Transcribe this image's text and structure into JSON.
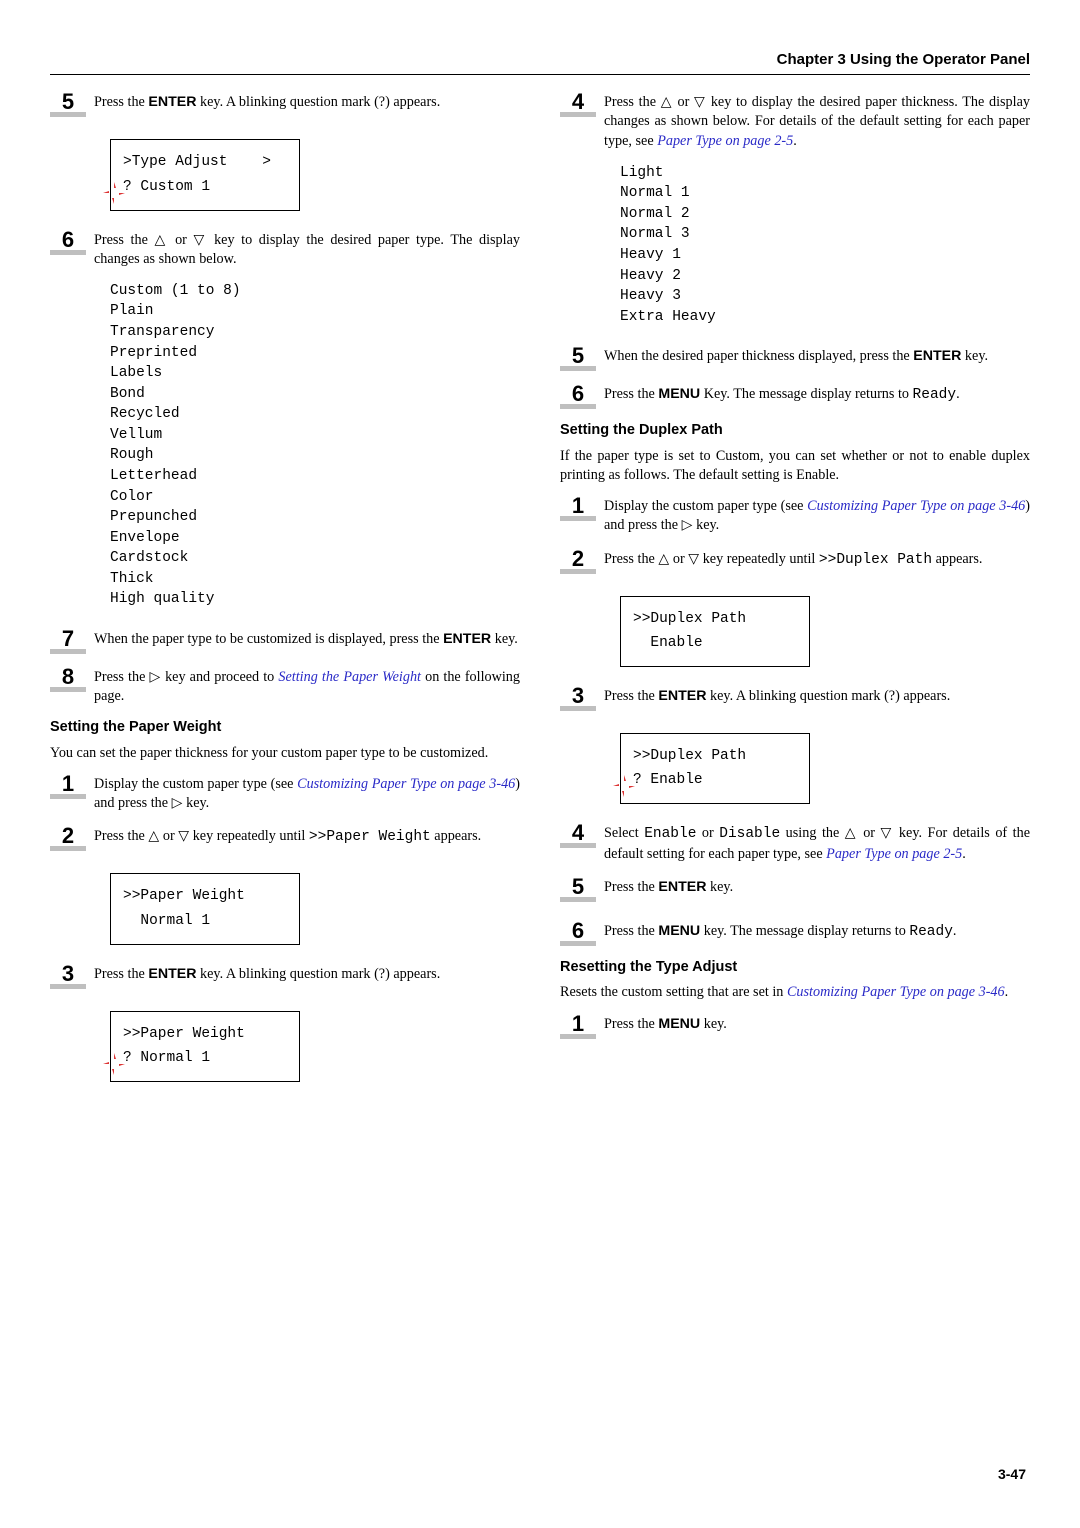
{
  "chapter_title": "Chapter 3  Using the Operator Panel",
  "page_number": "3-47",
  "glyph": {
    "up": "△",
    "down": "▽",
    "right": "▷"
  },
  "left": {
    "s5": {
      "num": "5",
      "text_a": "Press the ",
      "enter": "ENTER",
      "text_b": " key. A blinking question mark (?) appears."
    },
    "lcd1": {
      "l1": ">Type Adjust    >",
      "l2": "? Custom 1"
    },
    "s6": {
      "num": "6",
      "text_a": "Press the ",
      "or": " or ",
      "text_b": " key to display the desired paper type. The display changes as shown below."
    },
    "type_list": "Custom (1 to 8)\nPlain\nTransparency\nPreprinted\nLabels\nBond\nRecycled\nVellum\nRough\nLetterhead\nColor\nPrepunched\nEnvelope\nCardstock\nThick\nHigh quality",
    "s7": {
      "num": "7",
      "text": "When the paper type to be customized is displayed, press the ",
      "enter": "ENTER",
      "tail": " key."
    },
    "s8": {
      "num": "8",
      "text_a": "Press the ",
      "text_b": " key and proceed to ",
      "xref": "Setting the Paper Weight",
      "tail": " on the following page."
    },
    "h_weight": "Setting the Paper Weight",
    "p_weight": "You can set the paper thickness for your custom paper type to be customized.",
    "w1": {
      "num": "1",
      "text_a": "Display the custom paper type (see ",
      "xref": "Customizing Paper Type on page 3-46",
      "text_b": ") and press the ",
      "tail": " key."
    },
    "w2": {
      "num": "2",
      "text_a": "Press the ",
      "or": " or ",
      "text_b": " key repeatedly until ",
      "code": ">>Paper Weight",
      "tail": " appears."
    },
    "lcd2": {
      "l1": ">>Paper Weight",
      "l2": "  Normal 1"
    },
    "w3": {
      "num": "3",
      "text_a": "Press the ",
      "enter": "ENTER",
      "text_b": " key. A blinking question mark (?) appears."
    },
    "lcd3": {
      "l1": ">>Paper Weight",
      "l2": "? Normal 1"
    }
  },
  "right": {
    "r4": {
      "num": "4",
      "text_a": "Press the ",
      "or": " or ",
      "text_b": " key to display the desired paper thickness. The display changes as shown below. For details of the default setting for each paper type, see ",
      "xref": "Paper Type on page 2-5",
      "tail": "."
    },
    "thick_list": "Light\nNormal 1\nNormal 2\nNormal 3\nHeavy 1\nHeavy 2\nHeavy 3\nExtra Heavy",
    "r5": {
      "num": "5",
      "text_a": "When the desired paper thickness displayed, press the ",
      "enter": "ENTER",
      "tail": " key."
    },
    "r6": {
      "num": "6",
      "text_a": "Press the ",
      "menu": "MENU",
      "text_b": " Key. The message display returns to ",
      "code": "Ready",
      "tail": "."
    },
    "h_duplex": "Setting the Duplex Path",
    "p_duplex": "If the paper type is set to Custom, you can set whether or not to enable duplex printing as follows. The default setting is Enable.",
    "d1": {
      "num": "1",
      "text_a": "Display the custom paper type (see ",
      "xref": "Customizing Paper Type on page 3-46",
      "text_b": ") and press the ",
      "tail": " key."
    },
    "d2": {
      "num": "2",
      "text_a": "Press the ",
      "or": " or ",
      "text_b": " key repeatedly until ",
      "code": ">>Duplex Path",
      "tail": " appears."
    },
    "lcd_d1": {
      "l1": ">>Duplex Path",
      "l2": "  Enable"
    },
    "d3": {
      "num": "3",
      "text_a": "Press the ",
      "enter": "ENTER",
      "text_b": " key. A blinking question mark (?) appears."
    },
    "lcd_d2": {
      "l1": ">>Duplex Path",
      "l2": "? Enable"
    },
    "d4": {
      "num": "4",
      "text_a": "Select ",
      "code1": "Enable",
      "or_txt": " or ",
      "code2": "Disable",
      "text_b": " using the ",
      "or": " or ",
      "text_c": " key. For details of the default setting for each paper type, see ",
      "xref": "Paper Type on page 2-5",
      "tail": "."
    },
    "d5": {
      "num": "5",
      "text_a": "Press the ",
      "enter": "ENTER",
      "tail": " key."
    },
    "d6": {
      "num": "6",
      "text_a": "Press the ",
      "menu": "MENU",
      "text_b": " key. The message display returns to ",
      "code": "Ready",
      "tail": "."
    },
    "h_reset": "Resetting the Type Adjust",
    "p_reset_a": "Resets the custom setting that are set in ",
    "p_reset_xref": "Customizing Paper Type on page 3-46",
    "p_reset_b": ".",
    "t1": {
      "num": "1",
      "text_a": "Press the ",
      "menu": "MENU",
      "tail": " key."
    }
  }
}
